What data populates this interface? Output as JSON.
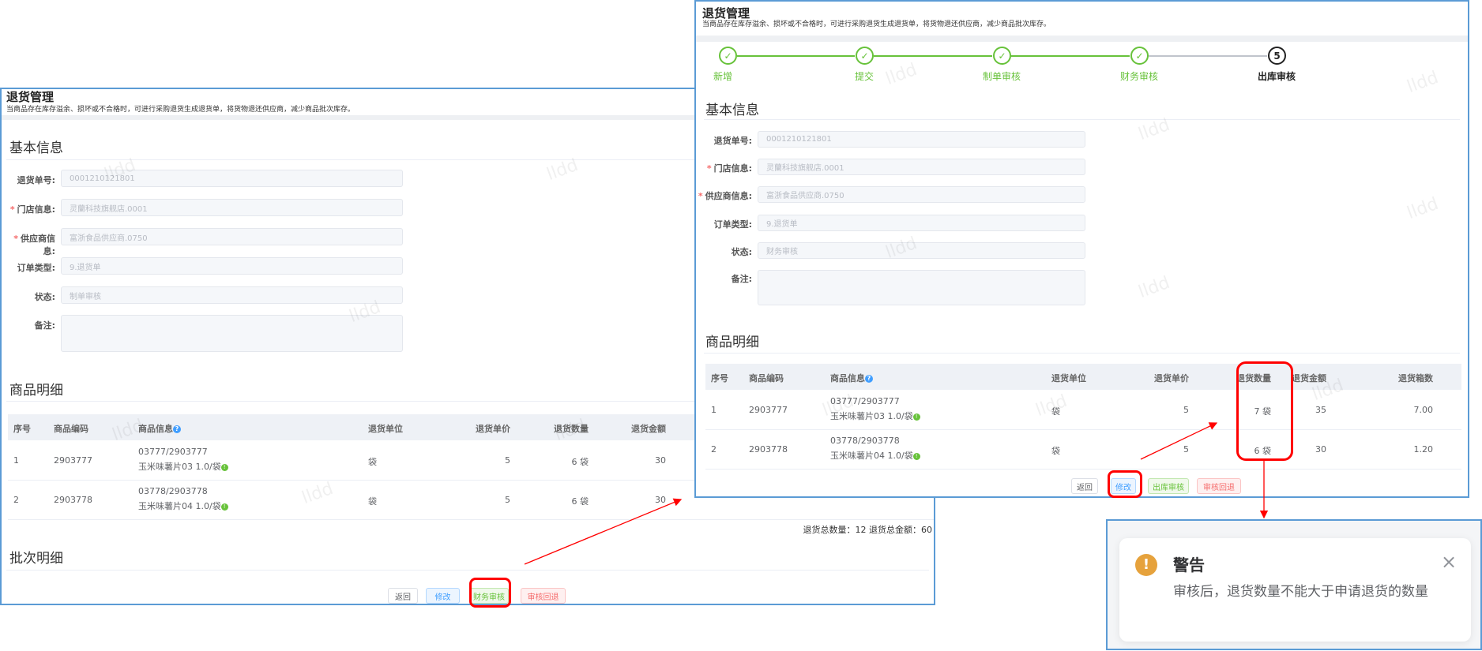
{
  "page": {
    "title": "退货管理",
    "description": "当商品存在库存溢余、损坏或不合格时，可进行采购退货生成退货单，将货物退还供应商，减少商品批次库存。"
  },
  "watermark": "lldd",
  "form_labels": {
    "return_no": "退货单号:",
    "store": "门店信息:",
    "supplier": "供应商信息:",
    "order_type": "订单类型:",
    "status": "状态:",
    "remark": "备注:"
  },
  "sections": {
    "basic": "基本信息",
    "goods": "商品明细",
    "batch": "批次明细"
  },
  "table_headers": [
    "序号",
    "商品编码",
    "商品信息",
    "退货单位",
    "退货单价",
    "退货数量",
    "退货金额",
    "退货箱数"
  ],
  "left": {
    "fields": {
      "return_no": "0001210121801",
      "store": "灵蘭科技旗舰店.0001",
      "supplier": "富浙食品供应商.0750",
      "order_type": "9.退货单",
      "status": "制单审核",
      "remark": ""
    },
    "rows": [
      {
        "index": "1",
        "code": "2903777",
        "info1": "03777/2903777",
        "info2": "玉米味薯片03 1.0/袋",
        "unit": "袋",
        "price": "5",
        "qty": "6 袋",
        "amount": "30"
      },
      {
        "index": "2",
        "code": "2903778",
        "info1": "03778/2903778",
        "info2": "玉米味薯片04 1.0/袋",
        "unit": "袋",
        "price": "5",
        "qty": "6 袋",
        "amount": "30"
      }
    ],
    "totals": "退货总数量：12 退货总金额：60",
    "buttons": {
      "back": "返回",
      "edit": "修改",
      "audit": "财务审核",
      "reject": "审核回退"
    }
  },
  "right": {
    "steps": [
      {
        "label": "新增",
        "done": true
      },
      {
        "label": "提交",
        "done": true
      },
      {
        "label": "制单审核",
        "done": true
      },
      {
        "label": "财务审核",
        "done": true
      },
      {
        "label": "出库审核",
        "done": false,
        "number": "5"
      }
    ],
    "fields": {
      "return_no": "0001210121801",
      "store": "灵蘭科技旗舰店.0001",
      "supplier": "富浙食品供应商.0750",
      "order_type": "9.退货单",
      "status": "财务审核",
      "remark": ""
    },
    "rows": [
      {
        "index": "1",
        "code": "2903777",
        "info1": "03777/2903777",
        "info2": "玉米味薯片03 1.0/袋",
        "unit": "袋",
        "price": "5",
        "qty": "7 袋",
        "amount": "35",
        "boxes": "7.00"
      },
      {
        "index": "2",
        "code": "2903778",
        "info1": "03778/2903778",
        "info2": "玉米味薯片04 1.0/袋",
        "unit": "袋",
        "price": "5",
        "qty": "6 袋",
        "amount": "30",
        "boxes": "1.20"
      }
    ],
    "buttons": {
      "back": "返回",
      "edit": "修改",
      "audit": "出库审核",
      "reject": "审核回退"
    }
  },
  "warning": {
    "title": "警告",
    "message": "审核后，退货数量不能大于申请退货的数量",
    "icon": "exclamation-circle-icon",
    "color": "#e6a23c"
  },
  "colors": {
    "border": "#5b9bd5",
    "success": "#67c23a",
    "primary": "#409eff",
    "danger": "#f56c6c",
    "annotation": "#ff0000"
  }
}
